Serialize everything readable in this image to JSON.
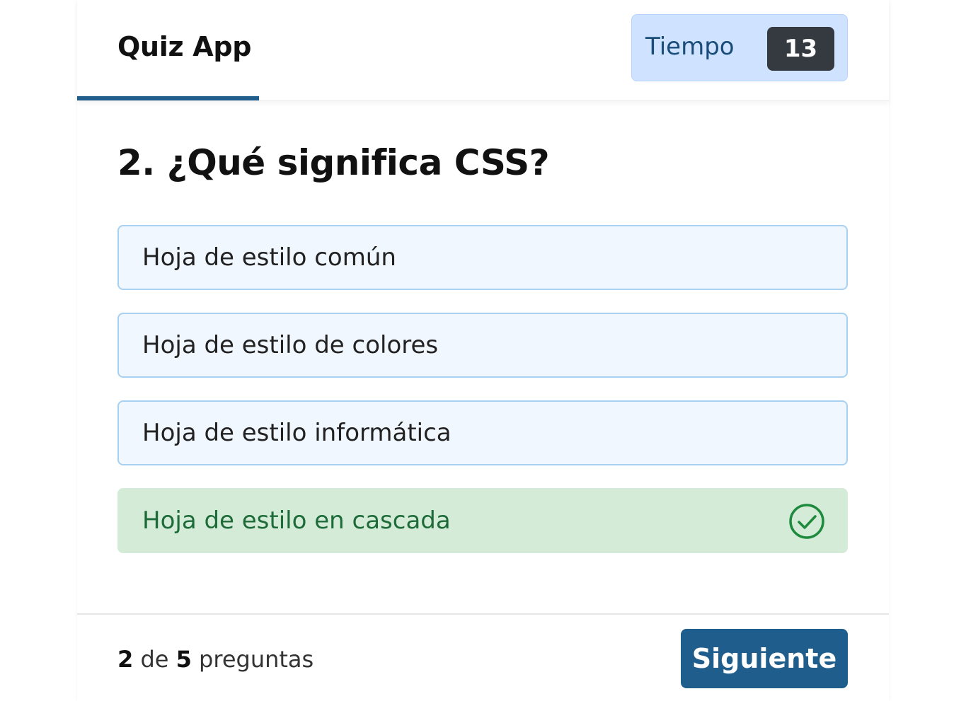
{
  "header": {
    "app_title": "Quiz App",
    "timer_label": "Tiempo",
    "timer_value": "13"
  },
  "question": {
    "text": "2. ¿Qué significa CSS?"
  },
  "options": [
    {
      "label": "Hoja de estilo común",
      "state": "default"
    },
    {
      "label": "Hoja de estilo de colores",
      "state": "default"
    },
    {
      "label": "Hoja de estilo informática",
      "state": "default"
    },
    {
      "label": "Hoja de estilo en cascada",
      "state": "correct",
      "icon": "check-circle-icon"
    }
  ],
  "footer": {
    "current": "2",
    "of_text": "de",
    "total": "5",
    "suffix": "preguntas",
    "next_label": "Siguiente"
  },
  "colors": {
    "primary": "#1f5e8c",
    "timer_bg": "#cfe2ff",
    "timer_badge": "#343a40",
    "option_bg": "#f0f7ff",
    "option_border": "#a8d0f0",
    "correct_bg": "#d4ebd7",
    "correct_text": "#1e6b3a"
  }
}
